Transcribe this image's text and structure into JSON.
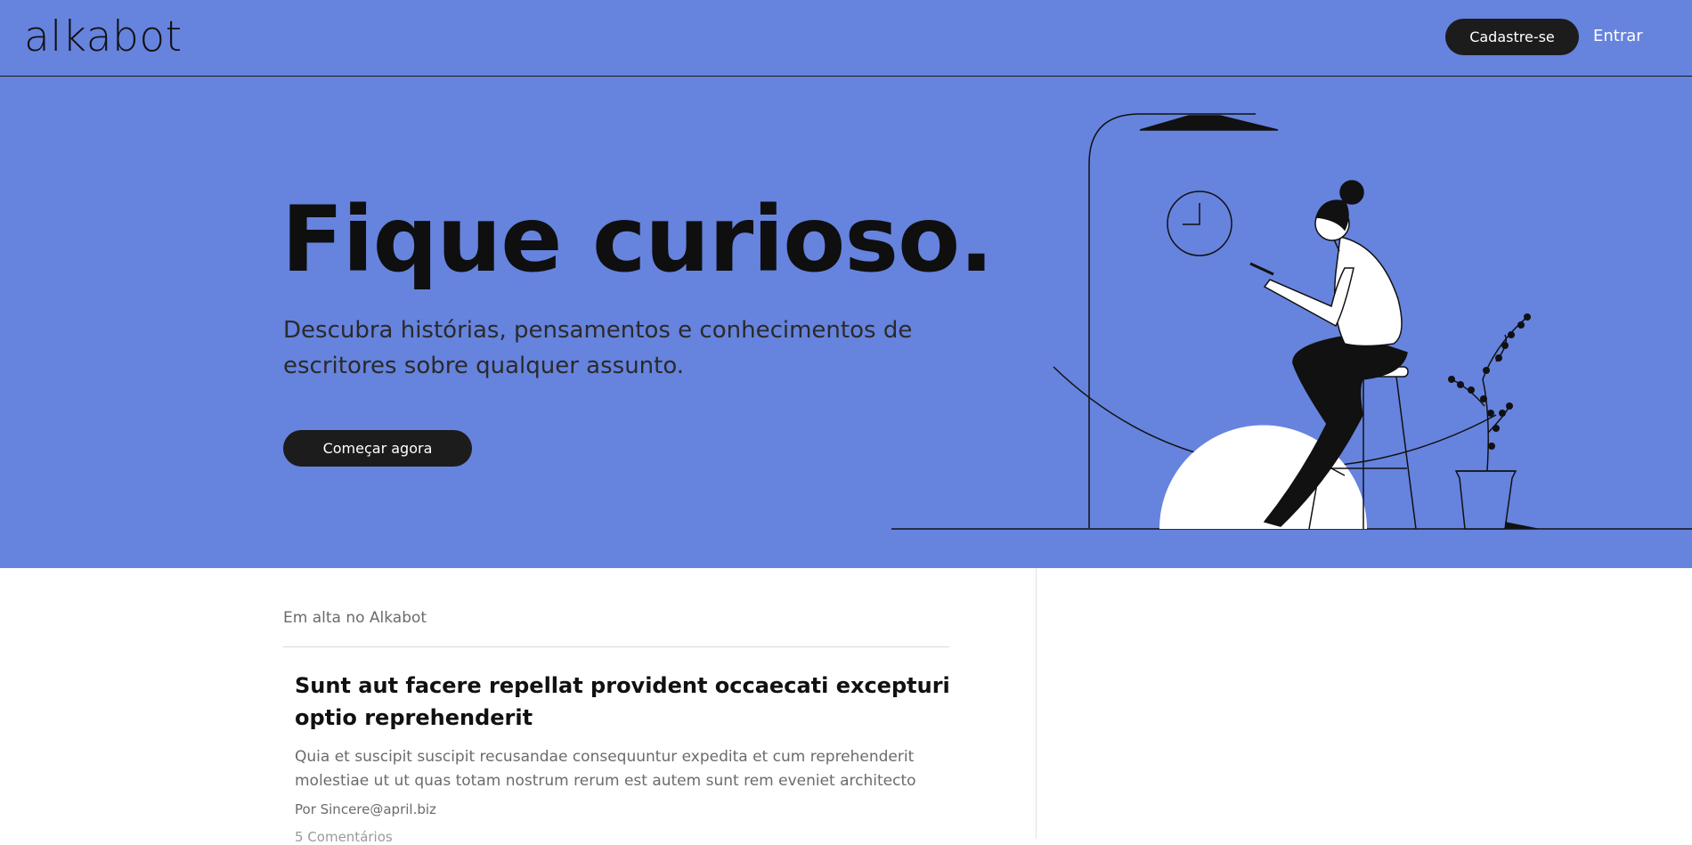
{
  "header": {
    "logo": "alkabot",
    "signup_label": "Cadastre-se",
    "login_label": "Entrar"
  },
  "hero": {
    "title": "Fique curioso.",
    "subtitle": "Descubra histórias, pensamentos e conhecimentos de escritores sobre qualquer assunto.",
    "cta_label": "Começar agora",
    "illustration_icon": "person-on-stool-with-phone-illustration"
  },
  "trending": {
    "label": "Em alta no Alkabot",
    "posts": [
      {
        "title": "Sunt aut facere repellat provident occaecati excepturi optio reprehenderit",
        "excerpt": "Quia et suscipit suscipit recusandae consequuntur expedita et cum reprehenderit molestiae ut ut quas totam nostrum rerum est autem sunt rem eveniet architecto",
        "author": "Por Sincere@april.biz",
        "comments": "5 Comentários"
      }
    ]
  },
  "colors": {
    "hero_bg": "#6683de",
    "button_bg": "#1c1c1c"
  }
}
